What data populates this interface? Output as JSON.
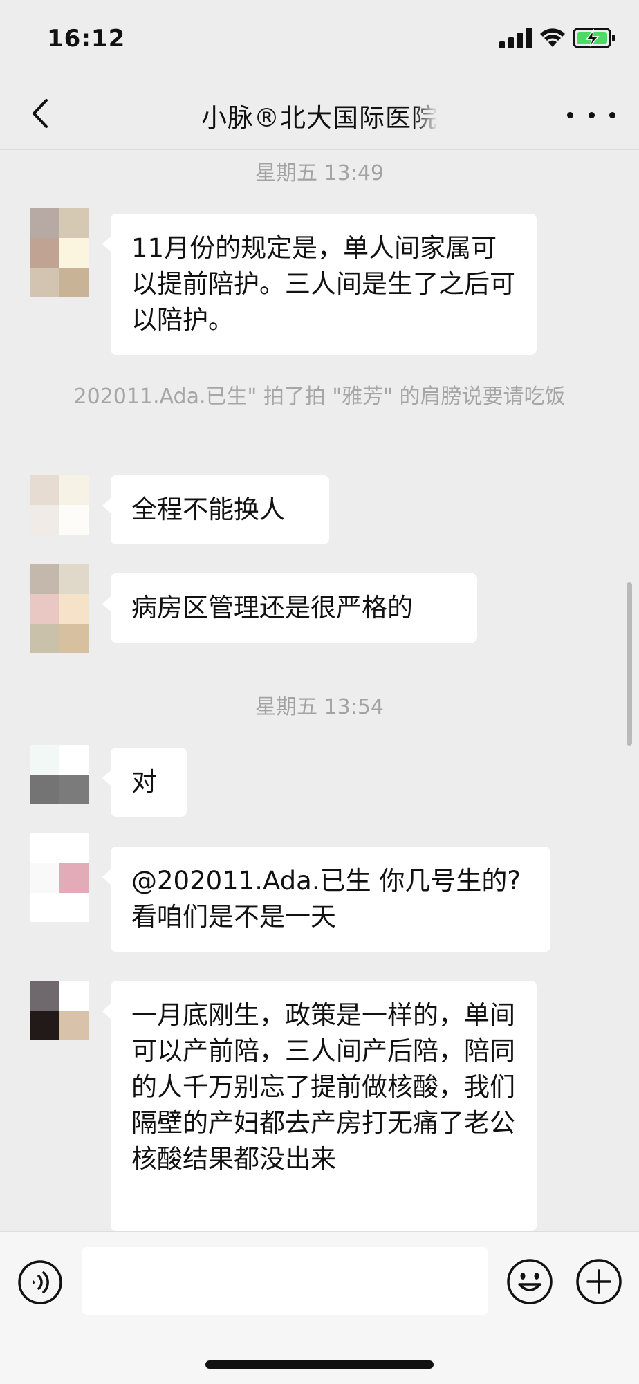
{
  "status_bar": {
    "time": "16:12"
  },
  "header": {
    "title": "小脉®北大国际医院"
  },
  "messages": [
    {
      "timestamp": "星期五 13:49"
    },
    {
      "text": "11月份的规定是，单人间家属可以提前陪护。三人间是生了之后可以陪护。"
    },
    {
      "system": "202011.Ada.已生\" 拍了拍 \"雅芳\" 的肩膀说要请吃饭"
    },
    {
      "text": "全程不能换人"
    },
    {
      "text": "病房区管理还是很严格的"
    },
    {
      "timestamp": "星期五 13:54"
    },
    {
      "text": "对"
    },
    {
      "text": "@202011.Ada.已生 你几号生的?看咱们是不是一天"
    },
    {
      "text": "一月底刚生，政策是一样的，单间可以产前陪，三人间产后陪，陪同的人千万别忘了提前做核酸，我们隔壁的产妇都去产房打无痛了老公核酸结果都没出来"
    }
  ],
  "avatars": [
    [
      "#b7aaa4",
      "#d5c9b4",
      "#c1a393",
      "#fbf4df",
      "#d3c3b1",
      "#c8b397"
    ],
    [
      "#e6dcd2",
      "#f6f2e6",
      "#f1ebe8",
      "#fdfcf8"
    ],
    [
      "#c4b7ac",
      "#e0d8c8",
      "#e9c7c3",
      "#f6e2c9",
      "#c9c1a9",
      "#d6c0a0"
    ],
    [
      "#f1f8f5",
      "#ffffff",
      "#747474",
      "#7b7b7c"
    ],
    [
      "#ffffff",
      "#ffffff",
      "#f9f9f9",
      "#e2abb7",
      "#ffffff",
      "#ffffff"
    ],
    [
      "#6f696e",
      "#ffffff",
      "#211a19",
      "#d8c2aa"
    ]
  ],
  "colors": {
    "background": "#ededed",
    "bubble": "#ffffff",
    "timestamp": "#a3a3a3"
  },
  "icons": {
    "back": "chevron-left-icon",
    "more": "more-dots-icon",
    "voice": "voice-icon",
    "emoji": "emoji-icon",
    "plus": "plus-icon",
    "signal": "signal-icon",
    "wifi": "wifi-icon",
    "battery": "battery-charging-icon"
  },
  "input": {
    "value": ""
  }
}
